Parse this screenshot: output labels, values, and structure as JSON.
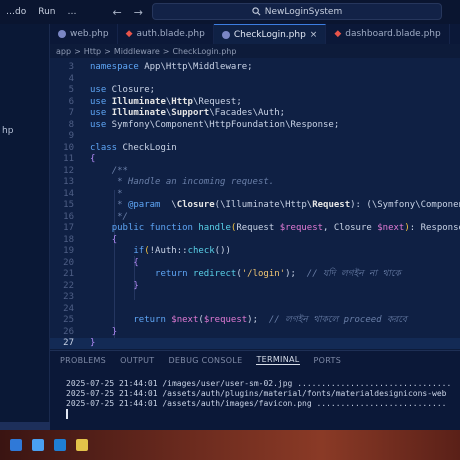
{
  "titlebar": {
    "menu": [
      "…do",
      "Run",
      "…"
    ],
    "nav_back": "←",
    "nav_forward": "→",
    "search_label": "NewLoginSystem"
  },
  "sidebar": {
    "visible_item": "hp"
  },
  "tabs": [
    {
      "label": "web.php",
      "icon": "php-icon",
      "active": false
    },
    {
      "label": "auth.blade.php",
      "icon": "laravel-icon",
      "active": false
    },
    {
      "label": "CheckLogin.php",
      "icon": "php-icon",
      "active": true
    },
    {
      "label": "dashboard.blade.php",
      "icon": "laravel-icon",
      "active": false
    }
  ],
  "tab_close": "×",
  "breadcrumb": [
    "app",
    "Http",
    "Middleware",
    "CheckLogin.php"
  ],
  "breadcrumb_sep": ">",
  "editor": {
    "lines": [
      {
        "n": "3",
        "html": "<span class=\"kw\">namespace</span> App\\Http\\Middleware;"
      },
      {
        "n": "4",
        "html": ""
      },
      {
        "n": "5",
        "html": "<span class=\"kw\">use</span> Closure;"
      },
      {
        "n": "6",
        "html": "<span class=\"kw\">use</span> <span class=\"cls\">Illuminate</span>\\<span class=\"cls\">Http</span>\\Request;"
      },
      {
        "n": "7",
        "html": "<span class=\"kw\">use</span> <span class=\"cls\">Illuminate</span>\\<span class=\"cls\">Support</span>\\Facades\\Auth;"
      },
      {
        "n": "8",
        "html": "<span class=\"kw\">use</span> Symfony\\Component\\HttpFoundation\\Response;"
      },
      {
        "n": "9",
        "html": ""
      },
      {
        "n": "10",
        "html": "<span class=\"kw\">class</span> CheckLogin"
      },
      {
        "n": "11",
        "html": "<span class=\"brace\">{</span>"
      },
      {
        "n": "12",
        "html": "    <span class=\"cmt\">/**</span>"
      },
      {
        "n": "13",
        "html": "     <span class=\"cmt\">* Handle an incoming request.</span>"
      },
      {
        "n": "14",
        "html": "     <span class=\"cmt\">*</span>"
      },
      {
        "n": "15",
        "html": "     <span class=\"cmt\">* </span><span class=\"kw\">@param</span>  \\<span class=\"cls\">Closure</span>(\\Illuminate\\Http\\<span class=\"cls\">Request</span>): (\\Symfony\\Component\\"
      },
      {
        "n": "16",
        "html": "     <span class=\"cmt\">*/</span>"
      },
      {
        "n": "17",
        "html": "    <span class=\"kw\">public function</span> <span class=\"fn\">handle</span><span class=\"paren\">(</span>Request <span class=\"var\">$request</span>, Closure <span class=\"var\">$next</span><span class=\"paren\">)</span>: Response"
      },
      {
        "n": "18",
        "html": "    <span class=\"brace\">{</span>"
      },
      {
        "n": "19",
        "html": "        <span class=\"kw\">if</span><span class=\"paren\">(</span>!Auth::<span class=\"fn\">check</span>())"
      },
      {
        "n": "20",
        "html": "        <span class=\"brace\">{</span>"
      },
      {
        "n": "21",
        "html": "            <span class=\"kw\">return</span> <span class=\"fn\">redirect</span>(<span class=\"str\">'/login'</span>);  <span class=\"cmt\">// যদি লগইন না থাকে</span>"
      },
      {
        "n": "22",
        "html": "        <span class=\"brace\">}</span>"
      },
      {
        "n": "23",
        "html": ""
      },
      {
        "n": "24",
        "html": ""
      },
      {
        "n": "25",
        "html": "        <span class=\"kw\">return</span> <span class=\"var\">$next</span>(<span class=\"var\">$request</span>);  <span class=\"cmt\">// লগইন থাকলে proceed করবে</span>"
      },
      {
        "n": "26",
        "html": "    <span class=\"brace\">}</span>"
      },
      {
        "n": "27",
        "html": "<span class=\"brace\">}</span>"
      }
    ]
  },
  "panel": {
    "tabs": [
      "PROBLEMS",
      "OUTPUT",
      "DEBUG CONSOLE",
      "TERMINAL",
      "PORTS"
    ],
    "active_tab": "TERMINAL",
    "terminal_lines": [
      "2025-07-25 21:44:01 /images/user/user-sm-02.jpg ................................",
      "2025-07-25 21:44:01 /assets/auth/plugins/material/fonts/materialdesignicons-web",
      "2025-07-25 21:44:01 /assets/auth/images/favicon.png ..........................."
    ]
  },
  "colors": {
    "accent": "#3c7de0",
    "editor_bg": "#0f2044",
    "keyword": "#5ea5f5",
    "laravel_red": "#e8544a"
  }
}
